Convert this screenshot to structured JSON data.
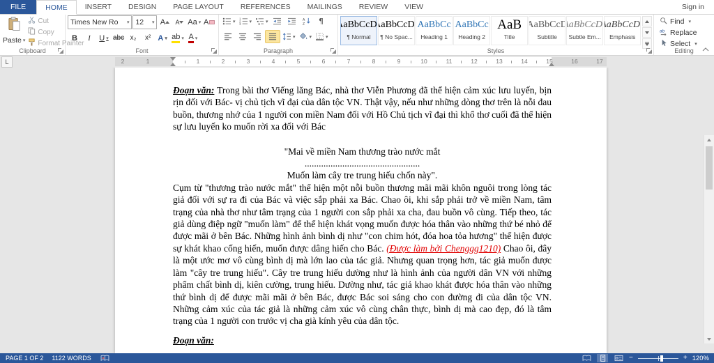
{
  "titlebar": {
    "sign_in": "Sign in"
  },
  "tabs": [
    "FILE",
    "HOME",
    "INSERT",
    "DESIGN",
    "PAGE LAYOUT",
    "REFERENCES",
    "MAILINGS",
    "REVIEW",
    "VIEW"
  ],
  "ribbon": {
    "clipboard": {
      "label": "Clipboard",
      "paste": "Paste",
      "cut": "Cut",
      "copy": "Copy",
      "format_painter": "Format Painter"
    },
    "font": {
      "label": "Font",
      "family": "Times New Ro",
      "size": "12",
      "grow": "A",
      "shrink": "A",
      "change_case": "Aa",
      "clear": "A",
      "bold": "B",
      "italic": "I",
      "underline": "U",
      "strike": "abc",
      "subscript": "x₂",
      "superscript": "x²",
      "effects": "A",
      "highlight": "ab",
      "color": "A"
    },
    "paragraph": {
      "label": "Paragraph",
      "pilcrow": "¶"
    },
    "styles": {
      "label": "Styles",
      "items": [
        {
          "sample": "AaBbCcDc",
          "name": "¶ Normal"
        },
        {
          "sample": "AaBbCcDc",
          "name": "¶ No Spac..."
        },
        {
          "sample": "AaBbCc",
          "name": "Heading 1"
        },
        {
          "sample": "AaBbCc",
          "name": "Heading 2"
        },
        {
          "sample": "AaB",
          "name": "Title"
        },
        {
          "sample": "AaBbCcD",
          "name": "Subtitle"
        },
        {
          "sample": "AaBbCcDc",
          "name": "Subtle Em..."
        },
        {
          "sample": "AaBbCcDc",
          "name": "Emphasis"
        }
      ]
    },
    "editing": {
      "label": "Editing",
      "find": "Find",
      "replace": "Replace",
      "select": "Select"
    }
  },
  "ruler": {
    "tab_selector": "L",
    "numbers": [
      "2",
      "1",
      "1",
      "2",
      "3",
      "4",
      "5",
      "6",
      "7",
      "8",
      "9",
      "10",
      "11",
      "12",
      "13",
      "14",
      "15",
      "16",
      "17"
    ]
  },
  "document": {
    "para1_lead": "Đoạn văn:",
    "para1_text": " Trong bài thơ Viếng lăng Bác, nhà thơ Viễn Phương đã thể hiện cảm xúc lưu luyến, bịn rịn đối với Bác- vị chủ tịch vĩ đại của dân tộc VN. Thật vậy, nếu như những dòng thơ trên là nỗi đau buồn, thương nhớ của 1 người con miền Nam đối với Hồ Chủ tịch vĩ đại thì khổ thơ cuối đã thể hiện sự lưu luyến ko muốn rời xa đối với Bác",
    "quote_line1": "\"Mai về miền Nam thương trào nước mắt",
    "quote_line2": ".................................................",
    "quote_line3": "Muốn làm cây tre trung hiếu chốn này\".",
    "body_before_red": "Cụm từ \"thương trào nước mắt\" thể hiện một nỗi buồn thương mãi mãi khôn nguôi trong lòng tác giả đối với sự ra đi của Bác và việc sắp phải xa Bác. Chao ôi, khi sắp phải trở về miền Nam, tâm trạng của nhà thơ như tâm trạng của 1 người con sắp phải xa cha, đau buồn vô cùng. Tiếp theo, tác giả dùng điệp ngữ \"muốn làm\" để thể hiện khát vọng muốn được hóa thân vào những thứ bé nhỏ để được mãi ở bên Bác. Những hình ảnh bình dị như \"con chim hót, đóa hoa tỏa hương\" thể hiện được sự khát khao cống hiến, muốn được dâng hiến cho Bác. ",
    "red_credit": "(Được làm bởi Chenggg1210)",
    "body_after_red": " Chao ôi, đây là một ước mơ vô cùng bình dị mà lớn lao của tác giả. Nhưng quan trọng hơn, tác giả muốn được làm \"cây tre trung hiếu\". Cây tre trung hiếu dường như là hình ảnh của người dân VN với những phẩm chất bình dị, kiên cường, trung hiếu. Dường như, tác giả khao khát được hóa thân vào những thứ bình dị để được mãi mãi ở bên Bác, được Bác soi sáng cho con đường đi của dân tộc VN. Những cảm xúc của tác giả là những cảm xúc vô cùng chân thực, bình dị mà cao đẹp, đó là tâm trạng của 1 người con trước vị cha già kính yêu của dân tộc.",
    "next_para_hint": "Đoạn văn:"
  },
  "statusbar": {
    "page": "PAGE 1 OF 2",
    "words": "1122 WORDS",
    "zoom_out": "−",
    "zoom_in": "+",
    "zoom": "120%"
  }
}
